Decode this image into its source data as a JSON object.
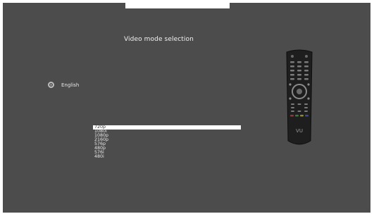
{
  "title": "Video mode selection",
  "language": {
    "icon": "radio-icon",
    "label": "English"
  },
  "video_modes": {
    "options": [
      "720p",
      "1080i",
      "1080p",
      "2160p",
      "576p",
      "480p",
      "576i",
      "480i"
    ],
    "selected_index": 0
  },
  "remote": {
    "brand_mark": "VU",
    "icon": "remote-control-icon"
  },
  "colors": {
    "background": "#4c4c4c",
    "selection": "#ffffff",
    "text": "#e8e8e8"
  }
}
